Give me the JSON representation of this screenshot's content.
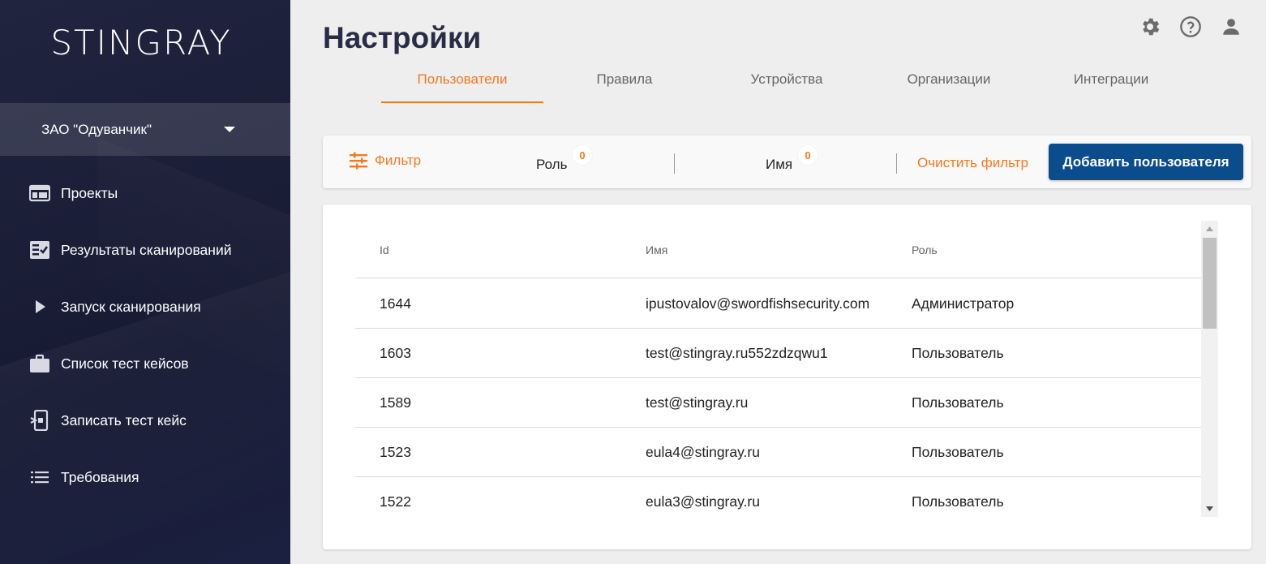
{
  "app": {
    "logo": "STINGRAY"
  },
  "sidebar": {
    "org_selector": {
      "label": "ЗАО \"Одуванчик\"",
      "icon": "chevron-down-icon"
    },
    "items": [
      {
        "label": "Проекты",
        "icon": "projects-icon"
      },
      {
        "label": "Результаты сканирований",
        "icon": "scan-results-icon"
      },
      {
        "label": "Запуск сканирования",
        "icon": "play-icon"
      },
      {
        "label": "Список тест кейсов",
        "icon": "briefcase-icon"
      },
      {
        "label": "Записать тест кейс",
        "icon": "record-device-icon"
      },
      {
        "label": "Требования",
        "icon": "list-icon"
      }
    ]
  },
  "header": {
    "title": "Настройки",
    "icons": [
      "gear-icon",
      "help-icon",
      "user-icon"
    ]
  },
  "tabs": [
    {
      "label": "Пользователи",
      "active": true
    },
    {
      "label": "Правила",
      "active": false
    },
    {
      "label": "Устройства",
      "active": false
    },
    {
      "label": "Организации",
      "active": false
    },
    {
      "label": "Интеграции",
      "active": false
    }
  ],
  "filter_bar": {
    "filter_label": "Фильтр",
    "role_label": "Роль",
    "role_count": "0",
    "name_label": "Имя",
    "name_count": "0",
    "clear_label": "Очистить фильтр",
    "add_user_label": "Добавить пользователя"
  },
  "table": {
    "columns": [
      "Id",
      "Имя",
      "Роль"
    ],
    "rows": [
      {
        "id": "1644",
        "name": "ipustovalov@swordfishsecurity.com",
        "role": "Администратор"
      },
      {
        "id": "1603",
        "name": "test@stingray.ru552zdzqwu1",
        "role": "Пользователь"
      },
      {
        "id": "1589",
        "name": "test@stingray.ru",
        "role": "Пользователь"
      },
      {
        "id": "1523",
        "name": "eula4@stingray.ru",
        "role": "Пользователь"
      },
      {
        "id": "1522",
        "name": "eula3@stingray.ru",
        "role": "Пользователь"
      }
    ]
  },
  "colors": {
    "accent": "#f27a22",
    "primary_button": "#0b4c8c",
    "sidebar_bg": "#1a1d36",
    "title_text": "#2a2c45"
  }
}
